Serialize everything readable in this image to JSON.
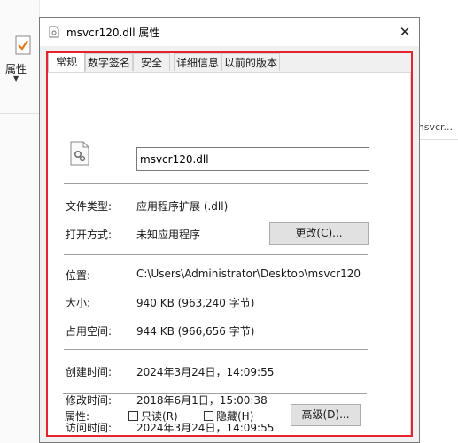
{
  "background": {
    "ribbon_button_label": "属性",
    "right_edge_text": "msvcr..."
  },
  "dialog": {
    "title": "msvcr120.dll 属性",
    "close_glyph": "✕",
    "tabs": [
      {
        "label": "常规",
        "active": true
      },
      {
        "label": "数字签名",
        "active": false
      },
      {
        "label": "安全",
        "active": false
      },
      {
        "label": "详细信息",
        "active": false
      },
      {
        "label": "以前的版本",
        "active": false
      }
    ],
    "file_name": "msvcr120.dll",
    "file_type_label": "文件类型:",
    "file_type_value": "应用程序扩展 (.dll)",
    "open_with_label": "打开方式:",
    "open_with_value": "未知应用程序",
    "change_button": "更改(C)...",
    "location_label": "位置:",
    "location_value": "C:\\Users\\Administrator\\Desktop\\msvcr120",
    "size_label": "大小:",
    "size_value": "940 KB (963,240 字节)",
    "size_on_disk_label": "占用空间:",
    "size_on_disk_value": "944 KB (966,656 字节)",
    "created_label": "创建时间:",
    "created_value": "2024年3月24日，14:09:55",
    "modified_label": "修改时间:",
    "modified_value": "2018年6月1日，15:00:38",
    "accessed_label": "访问时间:",
    "accessed_value": "2024年3月24日，14:09:55",
    "attributes_label": "属性:",
    "readonly_label": "只读(R)",
    "hidden_label": "隐藏(H)",
    "advanced_button": "高级(D)..."
  },
  "colors": {
    "highlight_frame": "#e3242b",
    "dialog_bg": "#f0f0f0",
    "button_bg": "#e1e1e1"
  },
  "icons": [
    "file-gear-icon",
    "checkmark-property-icon",
    "close-icon"
  ]
}
